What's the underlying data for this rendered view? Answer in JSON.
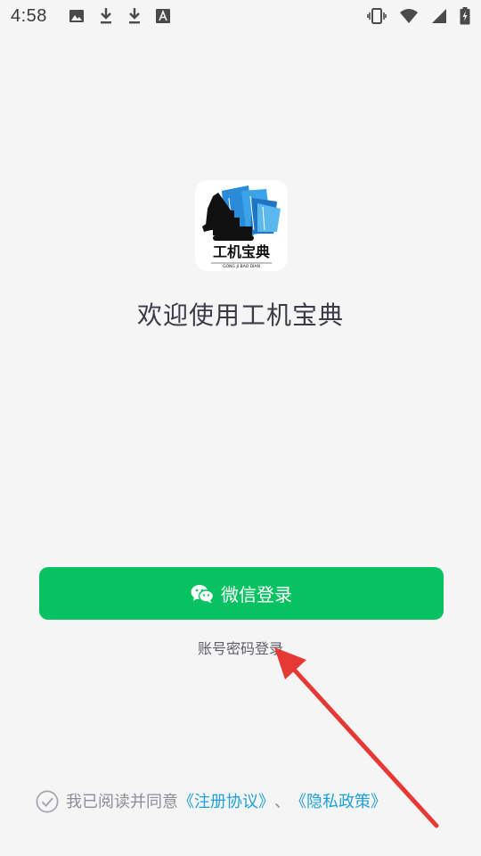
{
  "status_bar": {
    "time": "4:58",
    "left_icons": [
      "image-icon",
      "download-icon",
      "download-icon",
      "font-icon"
    ],
    "right_icons": [
      "vibrate-icon",
      "wifi-icon",
      "signal-icon",
      "battery-charging-icon"
    ]
  },
  "logo": {
    "text": "工机宝典",
    "subtext": "GONG JI BAO DIAN",
    "icon": "excavator-books-logo"
  },
  "welcome": {
    "title": "欢迎使用工机宝典"
  },
  "login": {
    "wechat_label": "微信登录",
    "wechat_icon": "wechat-icon",
    "account_label": "账号密码登录"
  },
  "agreement": {
    "prefix": "我已阅读并同意",
    "terms_link": "《注册协议》",
    "separator": "、",
    "privacy_link": "《隐私政策》",
    "checkbox_icon": "check-circle-icon"
  },
  "colors": {
    "background": "#f5f5f5",
    "wechat_green": "#08c160",
    "link_blue": "#1e9fd6",
    "annotation_red": "#e53935"
  }
}
